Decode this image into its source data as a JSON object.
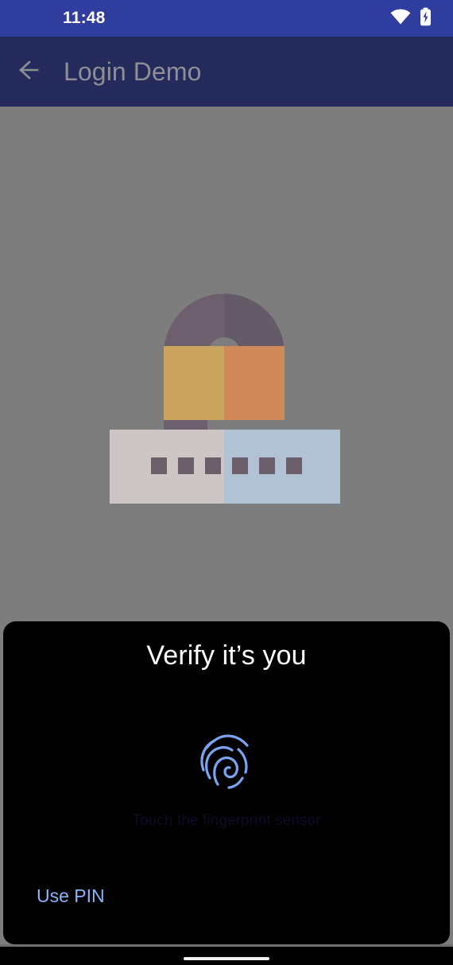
{
  "status_bar": {
    "time": "11:48",
    "icons": [
      "wifi-icon",
      "battery-charging-icon"
    ],
    "background_color": "#2f3e9e",
    "text_color": "#ffffff"
  },
  "app_bar": {
    "back_icon": "arrow-left-icon",
    "title": "Login Demo",
    "background_color": "#242b5c",
    "title_color": "#8e8e93"
  },
  "background": {
    "scrim_color": "#7d7d7d"
  },
  "illustration": {
    "name": "unlocked-padlock-with-password-field",
    "shackle_color_left": "#6e5f6e",
    "shackle_color_right": "#655a67",
    "body_color_left": "#cba45f",
    "body_color_right": "#d08a5a",
    "field_color_left": "#cdc6c5",
    "field_color_right": "#b0c2d3",
    "dot_color": "#6b5f6b",
    "dot_count": 6
  },
  "biometric_dialog": {
    "title": "Verify it’s you",
    "fingerprint_icon": "fingerprint-icon",
    "fingerprint_color": "#7ba4f0",
    "hint": "Touch the fingerprint sensor",
    "hint_color": "#0c0c27",
    "negative_button": "Use PIN",
    "negative_button_color": "#8ab4f8",
    "background_color": "#000000"
  },
  "nav_bar": {
    "gesture_pill": "home-gesture-pill",
    "background_color": "#000000"
  }
}
